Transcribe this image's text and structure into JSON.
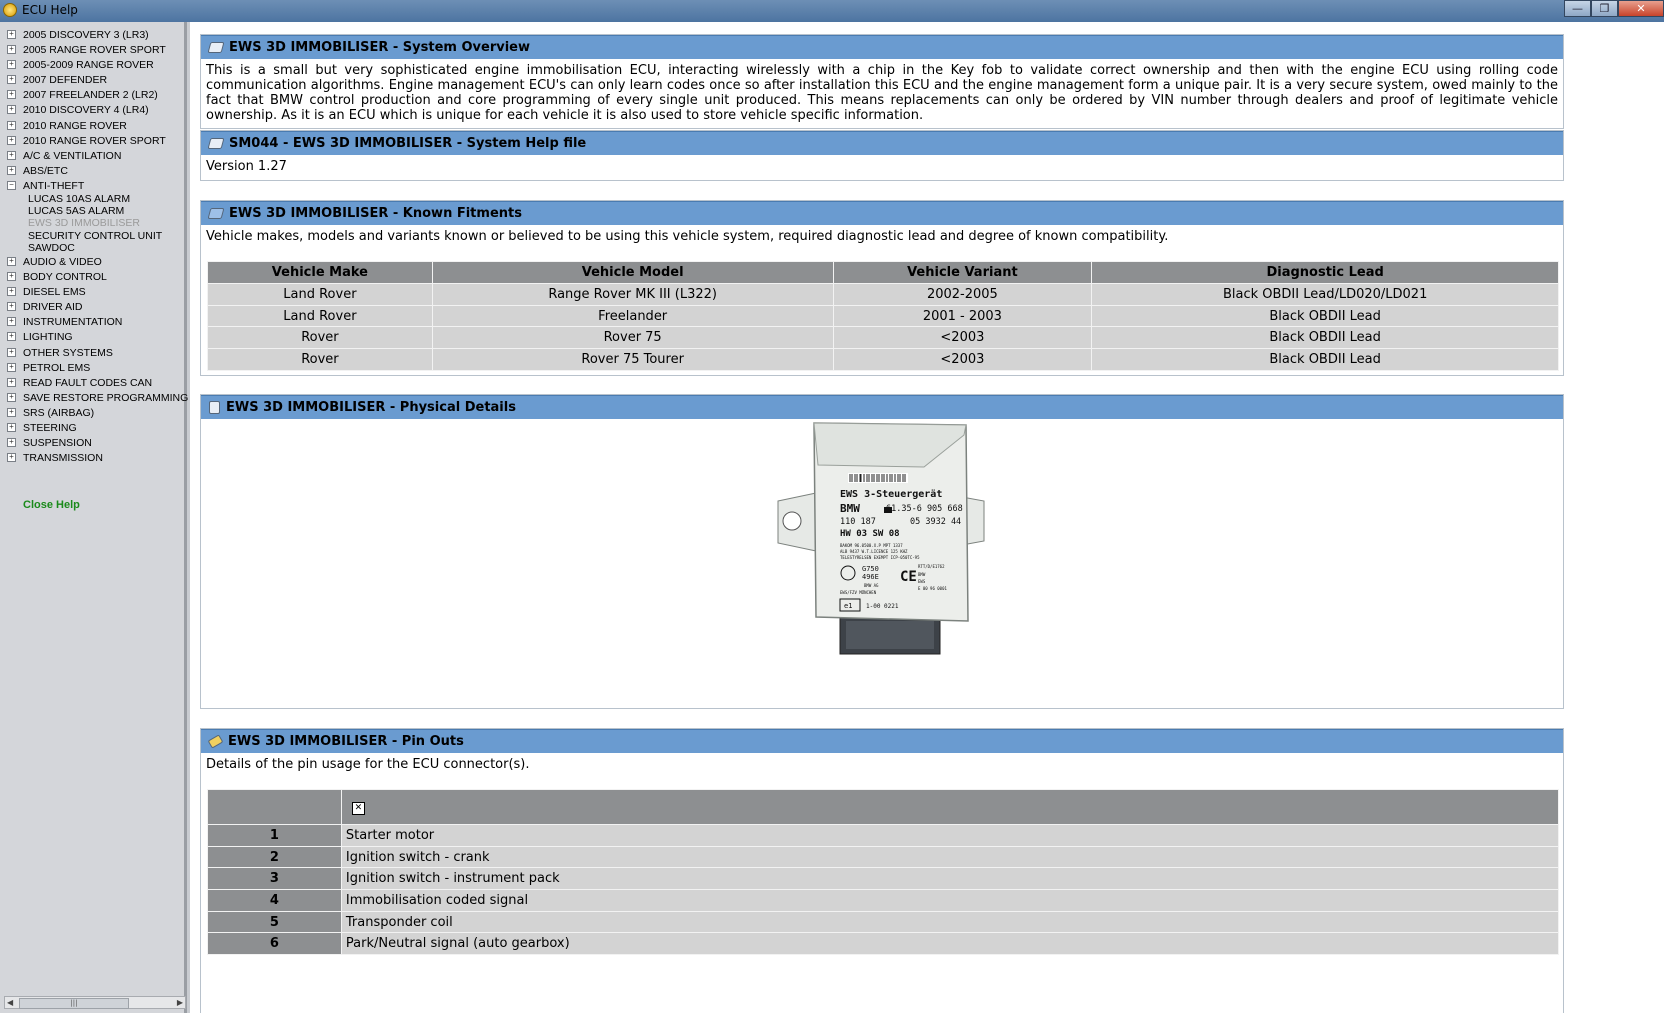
{
  "window": {
    "title": "ECU Help"
  },
  "sidebar": {
    "items_before": [
      "2005 DISCOVERY 3 (LR3)",
      "2005 RANGE ROVER SPORT",
      "2005-2009 RANGE ROVER",
      "2007 DEFENDER",
      "2007 FREELANDER 2 (LR2)",
      "2010 DISCOVERY 4 (LR4)",
      "2010 RANGE ROVER",
      "2010 RANGE ROVER SPORT",
      "A/C & VENTILATION",
      "ABS/ETC",
      "ANTI-THEFT"
    ],
    "anti_theft_children": [
      "LUCAS 10AS ALARM",
      "LUCAS 5AS ALARM",
      "EWS 3D IMMOBILISER",
      "SECURITY CONTROL UNIT",
      "SAWDOC"
    ],
    "items_after": [
      "AUDIO & VIDEO",
      "BODY CONTROL",
      "DIESEL EMS",
      "DRIVER AID",
      "INSTRUMENTATION",
      "LIGHTING",
      "OTHER SYSTEMS",
      "PETROL EMS",
      "READ FAULT CODES CAN",
      "SAVE RESTORE PROGRAMMING ENG",
      "SRS (AIRBAG)",
      "STEERING",
      "SUSPENSION",
      "TRANSMISSION"
    ],
    "close_help": "Close Help"
  },
  "overview": {
    "heading": "EWS 3D IMMOBILISER - System Overview",
    "text": "This is a small but very sophisticated engine immobilisation ECU, interacting wirelessly with a chip in the Key fob to validate correct ownership and then with the engine ECU using rolling code communication algorithms. Engine management ECU's can only learn codes once so after installation this ECU and the engine management form a unique pair. It is a very secure system, owed mainly to the fact that BMW control production and core programming of every single unit produced. This means replacements can only be ordered by VIN number through dealers and proof of legitimate vehicle ownership. As it is an ECU which is unique for each vehicle it is also used to store vehicle specific information."
  },
  "helpfile": {
    "heading": "SM044 - EWS 3D IMMOBILISER - System Help file",
    "version": "Version 1.27"
  },
  "fitments": {
    "heading": "EWS 3D IMMOBILISER - Known Fitments",
    "intro": "Vehicle makes, models and variants known or believed to be using this vehicle system, required diagnostic lead and degree of known compatibility.",
    "columns": [
      "Vehicle Make",
      "Vehicle Model",
      "Vehicle Variant",
      "Diagnostic Lead"
    ],
    "rows": [
      [
        "Land Rover",
        "Range Rover MK III (L322)",
        "2002-2005",
        "Black OBDII Lead/LD020/LD021"
      ],
      [
        "Land Rover",
        "Freelander",
        "2001 - 2003",
        "Black OBDII Lead"
      ],
      [
        "Rover",
        "Rover 75",
        "<2003",
        "Black OBDII Lead"
      ],
      [
        "Rover",
        "Rover 75 Tourer",
        "<2003",
        "Black OBDII Lead"
      ]
    ]
  },
  "physical": {
    "heading": "EWS 3D IMMOBILISER - Physical Details",
    "label": {
      "line1": "EWS 3-Steuergerät",
      "line2a": "BMW",
      "line2b": "61.35-6 905 668",
      "line3a": "110 187",
      "line3b": "05 3932 44",
      "line4": "HW 03 SW 08",
      "small1": "BAKOM 96.0500.X.P  MPT 1337",
      "small2": "ALB 9437   W.T.LICENCE  125 KHZ",
      "small3": "TELESTYRELSEN  EXEMPT  ICP-050TC-95",
      "g750": "G750",
      "g496": "496E",
      "ce": "CE",
      "rightcol1": "RTT/D/E1762",
      "rightcol2": "BMW",
      "rightcol3": "EWS",
      "rightcol4": "E 00 96 0001",
      "bmwag": "BMW AG",
      "ewsfzv": "EWS/FZV  MÜNCHEN",
      "e1": "e1",
      "e1code": "1-00 0221"
    }
  },
  "pinouts": {
    "heading": "EWS 3D IMMOBILISER - Pin Outs",
    "intro": "Details of the pin usage for the ECU connector(s).",
    "broken_image_glyph": "✕",
    "rows": [
      {
        "num": "1",
        "desc": "Starter motor"
      },
      {
        "num": "2",
        "desc": "Ignition switch - crank"
      },
      {
        "num": "3",
        "desc": "Ignition switch - instrument pack"
      },
      {
        "num": "4",
        "desc": "Immobilisation coded signal"
      },
      {
        "num": "5",
        "desc": "Transponder coil"
      },
      {
        "num": "6",
        "desc": "Park/Neutral signal (auto gearbox)"
      }
    ]
  }
}
